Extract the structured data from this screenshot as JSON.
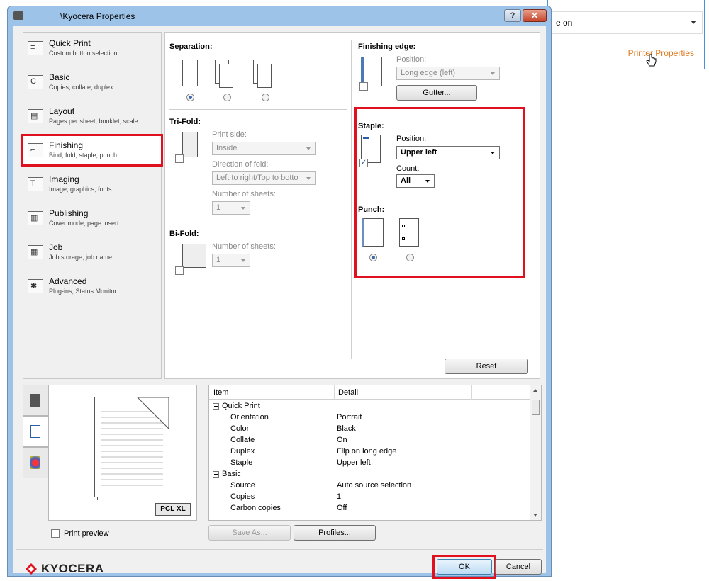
{
  "background_app": {
    "dropdown_text": "e on",
    "link_text": "Printer Properties"
  },
  "window": {
    "title": "\\Kyocera Properties",
    "help_label": "?",
    "close_label": "✕"
  },
  "nav": {
    "items": [
      {
        "label": "Quick Print",
        "sub": "Custom button selection",
        "icon": "quick-print-icon"
      },
      {
        "label": "Basic",
        "sub": "Copies, collate, duplex",
        "icon": "basic-icon"
      },
      {
        "label": "Layout",
        "sub": "Pages per sheet, booklet, scale",
        "icon": "layout-icon"
      },
      {
        "label": "Finishing",
        "sub": "Bind, fold, staple, punch",
        "icon": "finishing-icon"
      },
      {
        "label": "Imaging",
        "sub": "Image, graphics, fonts",
        "icon": "imaging-icon"
      },
      {
        "label": "Publishing",
        "sub": "Cover mode, page insert",
        "icon": "publishing-icon"
      },
      {
        "label": "Job",
        "sub": "Job storage, job name",
        "icon": "job-icon"
      },
      {
        "label": "Advanced",
        "sub": "Plug-ins, Status Monitor",
        "icon": "advanced-icon"
      }
    ],
    "selected": "Finishing"
  },
  "separation": {
    "title": "Separation:"
  },
  "trifold": {
    "title": "Tri-Fold:",
    "print_side_label": "Print side:",
    "print_side_value": "Inside",
    "direction_label": "Direction of fold:",
    "direction_value": "Left to right/Top to botto",
    "sheets_label": "Number of sheets:",
    "sheets_value": "1"
  },
  "bifold": {
    "title": "Bi-Fold:",
    "sheets_label": "Number of sheets:",
    "sheets_value": "1"
  },
  "finishing_edge": {
    "title": "Finishing edge:",
    "position_label": "Position:",
    "position_value": "Long edge (left)",
    "gutter_label": "Gutter..."
  },
  "staple": {
    "title": "Staple:",
    "position_label": "Position:",
    "position_value": "Upper left",
    "count_label": "Count:",
    "count_value": "All",
    "checked_mark": "✓"
  },
  "punch": {
    "title": "Punch:"
  },
  "reset_label": "Reset",
  "preview": {
    "badge": "PCL XL"
  },
  "summary": {
    "headers": [
      "Item",
      "Detail"
    ],
    "rows": [
      {
        "item": "Quick Print",
        "detail": "",
        "group": true
      },
      {
        "item": "Orientation",
        "detail": "Portrait",
        "group": false
      },
      {
        "item": "Color",
        "detail": "Black",
        "group": false
      },
      {
        "item": "Collate",
        "detail": "On",
        "group": false
      },
      {
        "item": "Duplex",
        "detail": "Flip on long edge",
        "group": false
      },
      {
        "item": "Staple",
        "detail": "Upper left",
        "group": false
      },
      {
        "item": "Basic",
        "detail": "",
        "group": true
      },
      {
        "item": "Source",
        "detail": "Auto source selection",
        "group": false
      },
      {
        "item": "Copies",
        "detail": "1",
        "group": false
      },
      {
        "item": "Carbon copies",
        "detail": "Off",
        "group": false
      }
    ]
  },
  "print_preview_label": "Print preview",
  "save_as_label": "Save As...",
  "profiles_label": "Profiles...",
  "ok_label": "OK",
  "cancel_label": "Cancel",
  "brand": "KYOCERA",
  "colors": {
    "highlight": "#e0101e",
    "link": "#e07a1f",
    "titlebar": "#9ec3e8"
  }
}
